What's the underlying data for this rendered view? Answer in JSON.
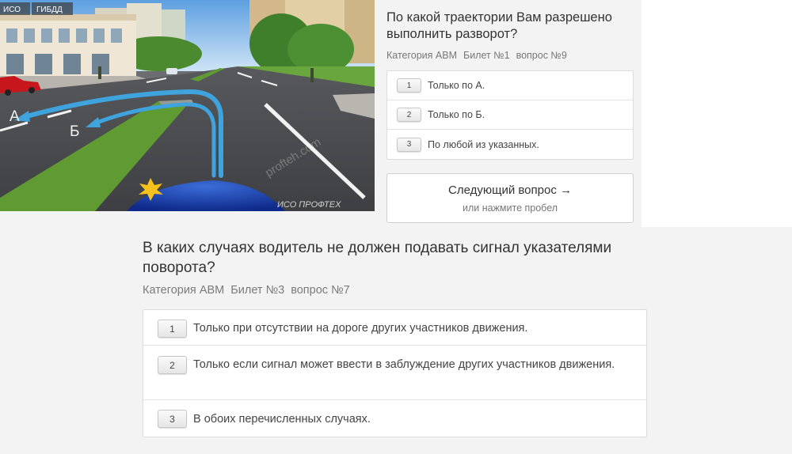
{
  "question1": {
    "image": {
      "badges": [
        "ИСО",
        "ГИБДД"
      ],
      "label_a": "А",
      "label_b": "Б",
      "watermark": "ИСО ПРОФТЕХ",
      "watermark_site": "profteh.com"
    },
    "title": "По какой траектории Вам разрешено выполнить разворот?",
    "meta": {
      "category": "Категория ABM",
      "ticket": "Билет №1",
      "question": "вопрос №9"
    },
    "answers": [
      {
        "num": "1",
        "text": "Только по А."
      },
      {
        "num": "2",
        "text": "Только по Б."
      },
      {
        "num": "3",
        "text": "По любой из указанных."
      }
    ],
    "next_button": {
      "label": "Следующий вопрос →",
      "hint": "или нажмите пробел"
    }
  },
  "question2": {
    "title": "В каких случаях водитель не должен подавать сигнал указателями поворота?",
    "meta": {
      "category": "Категория ABM",
      "ticket": "Билет №3",
      "question": "вопрос №7"
    },
    "answers": [
      {
        "num": "1",
        "text": "Только при отсутствии на дороге других участников движения."
      },
      {
        "num": "2",
        "text": "Только если сигнал может ввести в заблуждение других участников движения."
      },
      {
        "num": "3",
        "text": "В обоих перечисленных случаях."
      }
    ]
  },
  "colors": {
    "card_bg": "#f3f3f3",
    "border": "#dcdcdc",
    "arrow_blue": "#3fa3de",
    "grass": "#5f9a33",
    "asphalt": "#4a4b4e"
  }
}
